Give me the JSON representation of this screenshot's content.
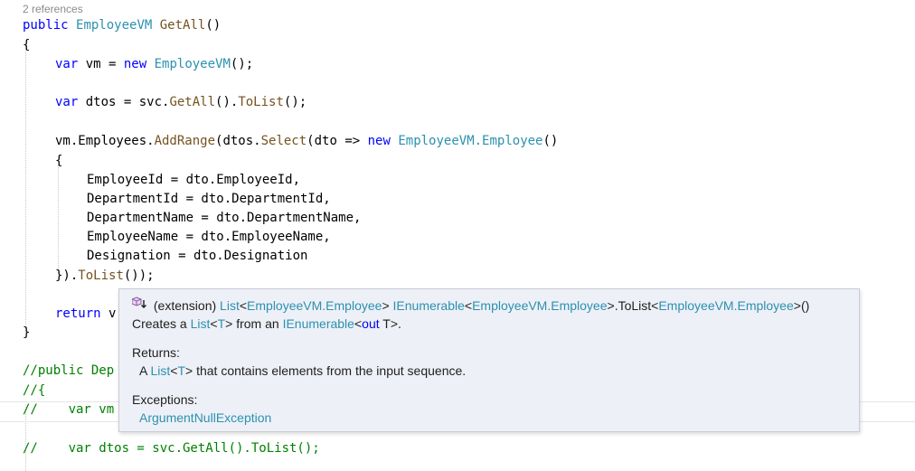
{
  "codelens": {
    "references": "2 references"
  },
  "code": {
    "kw_public": "public",
    "kw_var": "var",
    "kw_new": "new",
    "kw_return": "return",
    "type_employeevm": "EmployeeVM",
    "type_employeevm_employee": "EmployeeVM.Employee",
    "method_getall": "GetAll",
    "method_addrange": "AddRange",
    "method_select": "Select",
    "method_tolist": "ToList",
    "open_brace": "{",
    "close_brace": "}",
    "l1_tail": "()",
    "l3_a": " vm = ",
    "l3_tail": "();",
    "l5_a": " dtos = svc.",
    "l5_b": "().",
    "l5_tail": "();",
    "l7_a": "vm.Employees.",
    "l7_b": "(dtos.",
    "l7_c": "(dto => ",
    "l7_tail": "()",
    "assign1": "EmployeeId = dto.EmployeeId,",
    "assign2": "DepartmentId = dto.DepartmentId,",
    "assign3": "DepartmentName = dto.DepartmentName,",
    "assign4": "EmployeeName = dto.EmployeeName,",
    "assign5": "Designation = dto.Designation",
    "l14_a": "}).",
    "l14_tail": "());",
    "l16_tail": " v",
    "comment1": "//public Dep",
    "comment2": "//{",
    "comment3": "//    var vm",
    "comment4": "//    var dtos = svc.GetAll().ToList();"
  },
  "tooltip": {
    "icon": "extension-method-icon",
    "sig_prefix": " (extension) ",
    "sig_list": "List",
    "sig_lt": "<",
    "sig_gt": ">",
    "sig_emp": "EmployeeVM.Employee",
    "sig_space": " ",
    "sig_ienum": "IEnumerable",
    "sig_tolist": ".ToList",
    "sig_end": "()",
    "desc_a": "Creates a ",
    "desc_list": "List",
    "desc_t": "T",
    "desc_b": " from an ",
    "desc_ienum": "IEnumerable",
    "desc_out": "out",
    "desc_c": " T>.",
    "returns_label": "Returns:",
    "returns_a": "A ",
    "returns_list": "List",
    "returns_b": " that contains elements from the input sequence.",
    "exceptions_label": "Exceptions:",
    "exception_1": "ArgumentNullException"
  }
}
